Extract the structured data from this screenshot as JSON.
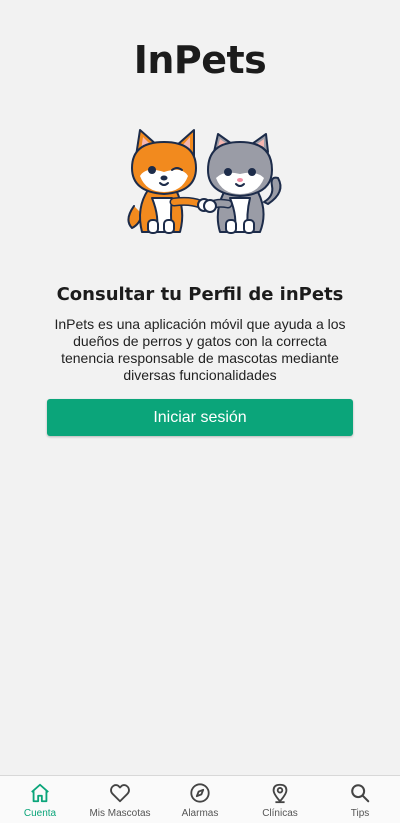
{
  "app": {
    "title": "InPets"
  },
  "hero": {
    "illustration": "dog-and-cat-fist-bump"
  },
  "profile": {
    "heading": "Consultar tu Perfil de inPets",
    "description": "InPets es una aplicación móvil que ayuda a los dueños de perros y gatos con la correcta tenencia responsable de mascotas mediante diversas funcionalidades",
    "login_label": "Iniciar sesión"
  },
  "nav": {
    "active": "Cuenta",
    "items": [
      {
        "label": "Cuenta",
        "icon": "home-icon"
      },
      {
        "label": "Mis Mascotas",
        "icon": "heart-icon"
      },
      {
        "label": "Alarmas",
        "icon": "compass-icon"
      },
      {
        "label": "Clínicas",
        "icon": "map-pin-icon"
      },
      {
        "label": "Tips",
        "icon": "search-icon"
      }
    ]
  },
  "colors": {
    "accent": "#0ba57a",
    "background": "#f2f2f2",
    "dog": "#f28a1e",
    "cat": "#9a9ca6"
  }
}
